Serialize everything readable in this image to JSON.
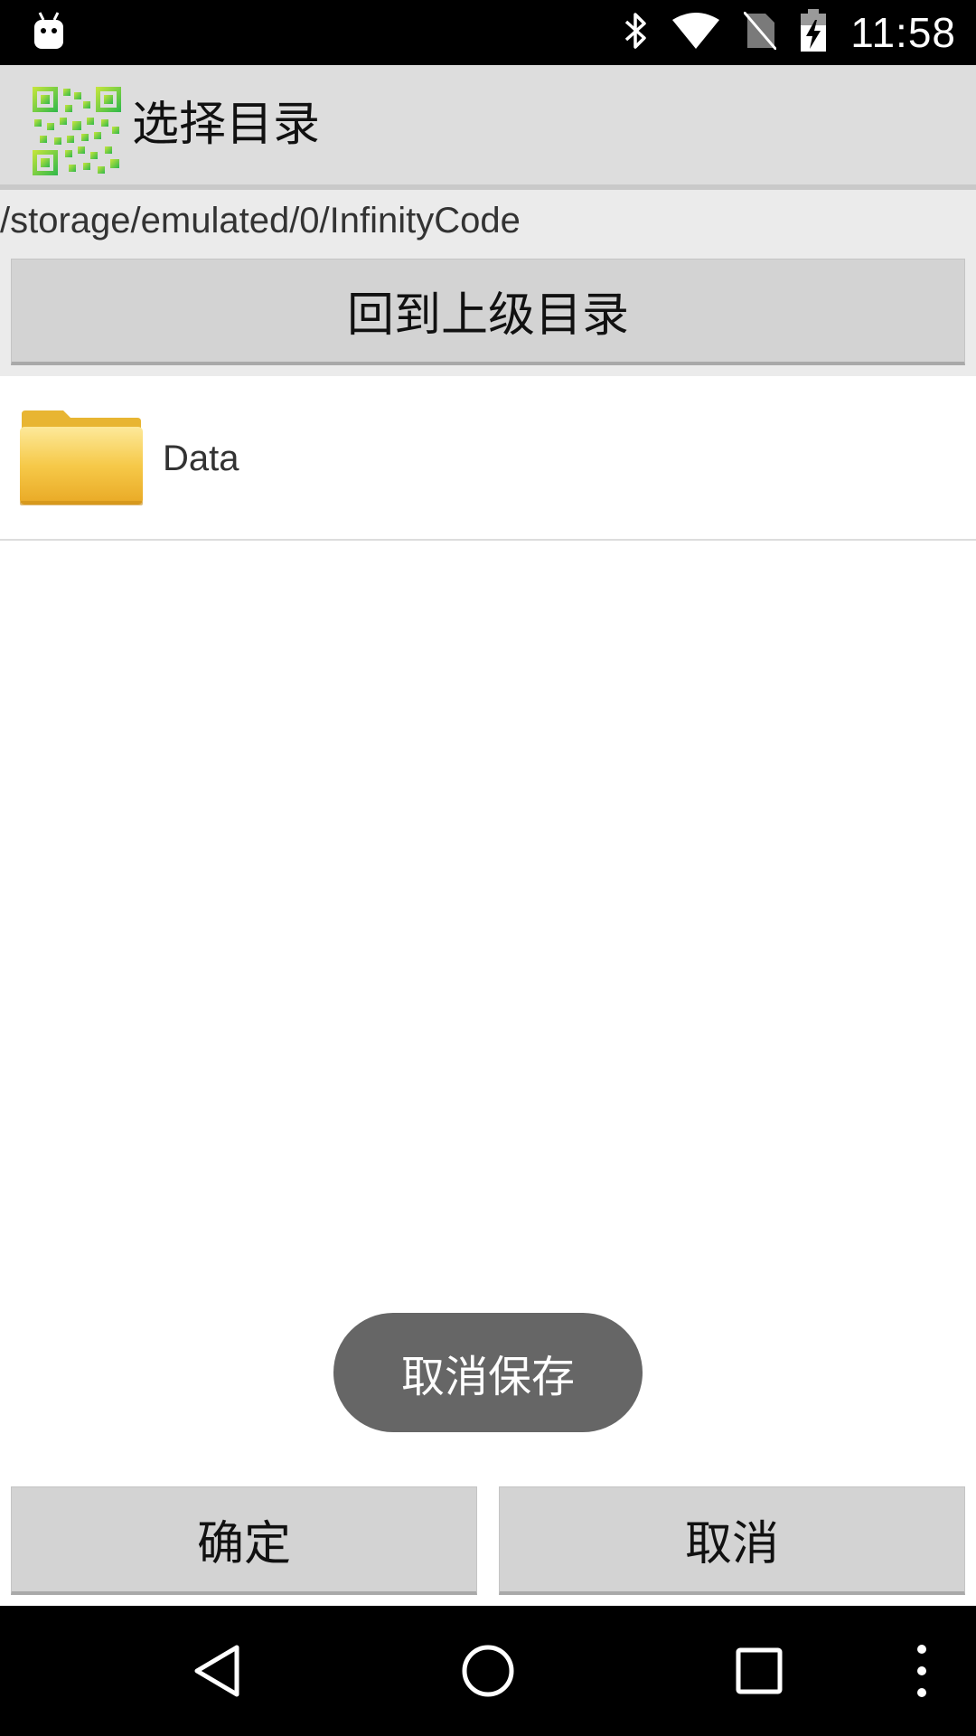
{
  "status_bar": {
    "time": "11:58",
    "icons": [
      "android-debug-icon",
      "bluetooth-icon",
      "wifi-icon",
      "no-sim-icon",
      "battery-charging-icon"
    ]
  },
  "action_bar": {
    "title": "选择目录",
    "icon": "qr-code-app-icon"
  },
  "path": {
    "current": "/storage/emulated/0/InfinityCode"
  },
  "buttons": {
    "up_label": "回到上级目录",
    "ok_label": "确定",
    "cancel_label": "取消"
  },
  "file_list": [
    {
      "name": "Data",
      "icon": "folder-icon"
    }
  ],
  "toast": {
    "message": "取消保存"
  },
  "nav_bar": {
    "icons": [
      "back-icon",
      "home-icon",
      "recents-icon",
      "overflow-menu-icon"
    ]
  },
  "colors": {
    "action_bar": "#dddddd",
    "path_panel": "#ebebeb",
    "button": "#d3d3d3",
    "toast": "#666666",
    "qr_green": "#3cbf3c",
    "folder_yellow": "#f4c340"
  }
}
